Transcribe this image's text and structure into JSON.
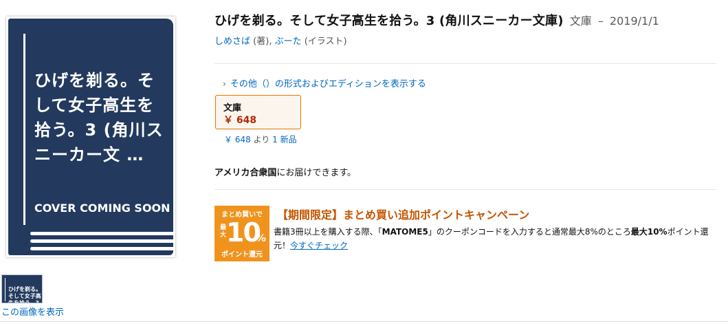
{
  "cover": {
    "title": "ひげを剃る。そして女子高生を拾う。3 (角川スニーカー文 …",
    "coming_soon": "COVER COMING SOON",
    "color": "#233a5e"
  },
  "thumbnail": {
    "text": "ひげを剃る。そして女子高生を拾う。3 (角川ス"
  },
  "view_image_link": "この画像を表示",
  "product": {
    "title": "ひげを剃る。そして女子高生を拾う。3 (角川スニーカー文庫)",
    "format": "文庫",
    "dash": "–",
    "date": "2019/1/1"
  },
  "contributors": [
    {
      "name": "しめさば",
      "role": "(著)"
    },
    {
      "name": "ぶーた",
      "role": "(イラスト)"
    }
  ],
  "other_formats_link": "その他（）の形式およびエディションを表示する",
  "format_option": {
    "label": "文庫",
    "price": "￥ 648"
  },
  "offers": {
    "price_link": "￥ 648",
    "from_text": "より",
    "new_link": "1 新品"
  },
  "shipping": {
    "country": "アメリカ合衆国",
    "message": "にお届けできます。"
  },
  "promo": {
    "badge_top": "まとめ買いで",
    "badge_max": "最大",
    "badge_number": "10",
    "badge_percent": "%",
    "badge_bottom": "ポイント還元",
    "title": "【期間限定】まとめ買い追加ポイントキャンペーン",
    "body_1": "書籍3冊以上を購入する際、「",
    "code": "MATOME5",
    "body_2": "」のクーポンコードを入力すると通常最大8%のところ",
    "highlight": "最大10%",
    "body_3": "ポイント還元！",
    "check_link": "今すぐチェック"
  },
  "colors": {
    "link": "#0066c0",
    "price": "#b12704",
    "promo_orange": "#f0931d",
    "promo_title": "#c45500",
    "selected_border": "#e77600"
  }
}
